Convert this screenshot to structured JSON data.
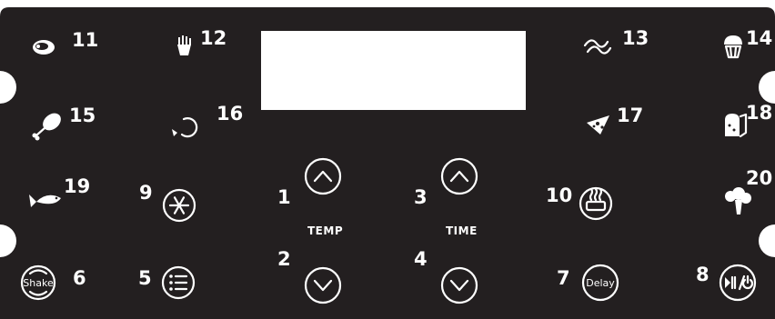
{
  "colors": {
    "panel": "#231f20",
    "foreground": "#ffffff",
    "display": "#ffffff",
    "background": "#ffffff"
  },
  "presets": [
    {
      "number": "11",
      "icon": "steak-icon"
    },
    {
      "number": "12",
      "icon": "fries-icon"
    },
    {
      "number": "13",
      "icon": "bacon-icon"
    },
    {
      "number": "14",
      "icon": "muffin-icon"
    },
    {
      "number": "15",
      "icon": "chicken-drumstick-icon"
    },
    {
      "number": "16",
      "icon": "shrimp-icon"
    },
    {
      "number": "17",
      "icon": "pizza-icon"
    },
    {
      "number": "18",
      "icon": "bread-icon"
    },
    {
      "number": "19",
      "icon": "fish-icon"
    },
    {
      "number": "20",
      "icon": "broccoli-icon"
    }
  ],
  "buttons": {
    "shake": {
      "number": "6",
      "text": "Shake",
      "icon": "shake-icon"
    },
    "menu": {
      "number": "5",
      "icon": "menu-icon"
    },
    "defrost": {
      "number": "9",
      "icon": "snowflake-icon"
    },
    "temp_up": {
      "number": "1",
      "icon": "chevron-up-icon"
    },
    "temp_down": {
      "number": "2",
      "icon": "chevron-down-icon"
    },
    "time_up": {
      "number": "3",
      "icon": "chevron-up-icon"
    },
    "time_down": {
      "number": "4",
      "icon": "chevron-down-icon"
    },
    "keep_warm": {
      "number": "10",
      "icon": "heat-tray-icon"
    },
    "delay": {
      "number": "7",
      "text": "Delay",
      "icon": "delay-icon"
    },
    "start_power": {
      "number": "8",
      "icon": "play-pause-power-icon"
    }
  },
  "captions": {
    "temp": "TEMP",
    "time": "TIME"
  }
}
